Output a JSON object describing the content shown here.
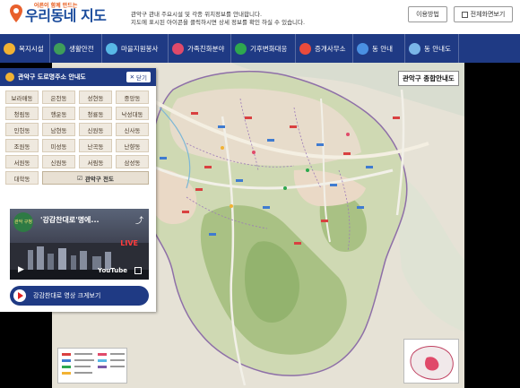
{
  "header": {
    "logo_small": "어른이 함께 만드는",
    "logo_main": "우리동네 지도",
    "desc_line1": "관악구 관내 주요시설 및 각종 위치정보를 안내합니다.",
    "desc_line2": "지도에 표시된 아이콘을 클릭하시면 상세 정보를 확인 하실 수 있습니다.",
    "usage_button": "이용방법",
    "fullscreen_button": "전체화면보기"
  },
  "nav": {
    "items": [
      {
        "label": "복지시설",
        "color": "#f2b233"
      },
      {
        "label": "생활안전",
        "color": "#3e9d5a"
      },
      {
        "label": "마을지원봉사",
        "color": "#58b8e6"
      },
      {
        "label": "가족친화분야",
        "color": "#e04a6a"
      },
      {
        "label": "기후변화대응",
        "color": "#2ea84e"
      },
      {
        "label": "증개사무소",
        "color": "#e94b3c"
      },
      {
        "label": "동 안내",
        "color": "#4a90e2"
      },
      {
        "label": "동 안내도",
        "color": "#7ab6e8"
      }
    ]
  },
  "panel": {
    "title": "관악구 도로명주소 안내도",
    "close_label": "닫기",
    "dongs": [
      "보라매동",
      "은천동",
      "성현동",
      "중앙동",
      "청림동",
      "행운동",
      "청룡동",
      "낙성대동",
      "인헌동",
      "남현동",
      "신원동",
      "서원동",
      "신림동",
      "서림동",
      "난곡동",
      "난향동",
      "조원동",
      "미성동",
      "삼성동",
      "대학동",
      "청룡동",
      "행운동",
      "신사동",
      "서원동"
    ],
    "dong_list": [
      "보라매동",
      "은천동",
      "성현동",
      "중앙동",
      "청림동",
      "행운동",
      "청룡동",
      "낙성대동",
      "인헌동",
      "남현동",
      "신원동",
      "신사동",
      "조원동",
      "미성동",
      "난곡동",
      "난향동",
      "서원동",
      "신원동",
      "서림동",
      "삼성동",
      "대학동"
    ],
    "all_label": "관악구 전도",
    "video": {
      "channel": "관악 구청",
      "title": "'강감찬대로'명에...",
      "live": "LIVE",
      "brand": "YouTube"
    },
    "watch_label": "강감찬대로 영상 크게보기"
  },
  "map": {
    "title": "관악구 종합안내도"
  }
}
